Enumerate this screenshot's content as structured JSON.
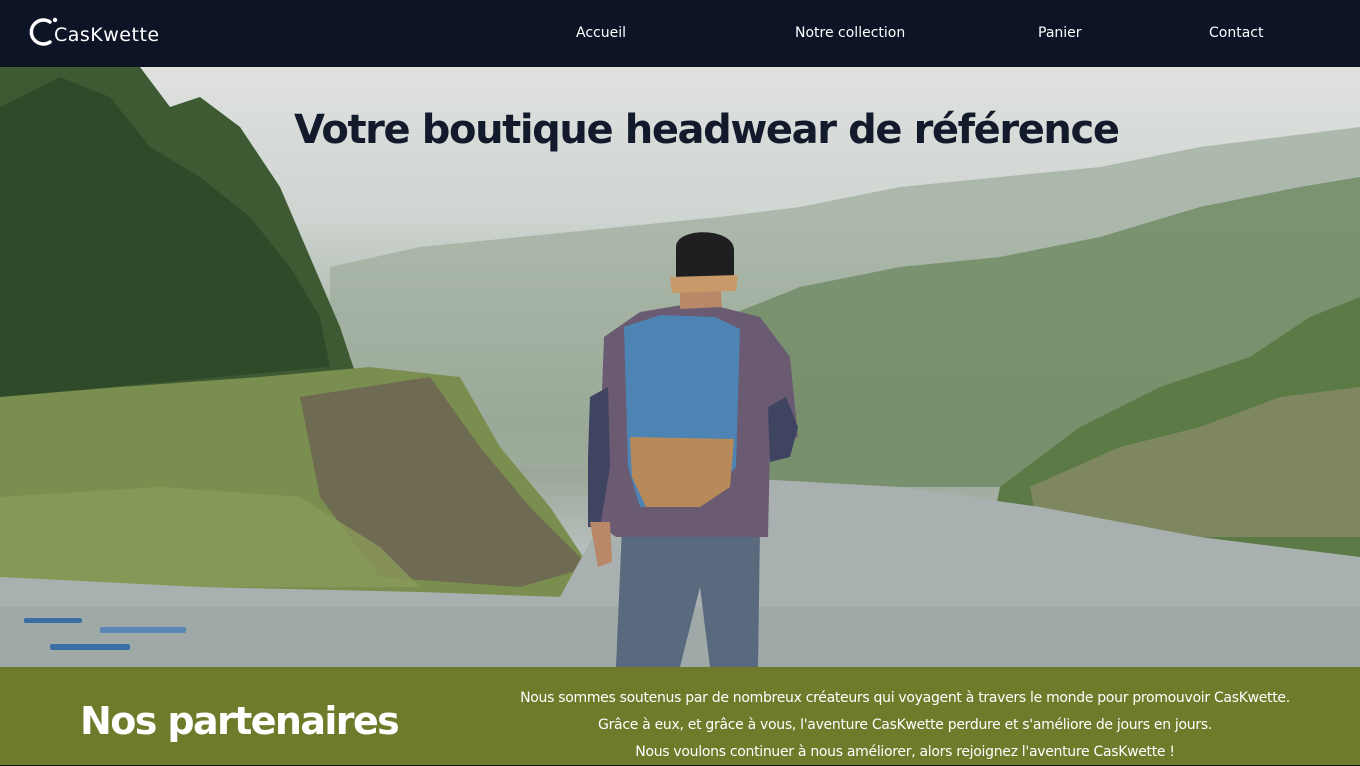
{
  "brand": {
    "name": "CasKwette"
  },
  "nav": {
    "items": [
      {
        "label": "Accueil"
      },
      {
        "label": "Notre collection"
      },
      {
        "label": "Panier"
      },
      {
        "label": "Contact"
      }
    ]
  },
  "hero": {
    "title": "Votre boutique headwear de référence",
    "image": "photo-hiker-with-cap-and-backpack-overlooking-lake-and-forested-hills"
  },
  "partners": {
    "title": "Nos partenaires",
    "lines": [
      "Nous sommes soutenus par de nombreux créateurs qui voyagent à travers le monde pour promouvoir CasKwette.",
      "Grâce à eux, et grâce à vous, l'aventure CasKwette perdure et s'améliore de jours en jours.",
      "Nous voulons continuer à nous améliorer, alors rejoignez l'aventure CasKwette !"
    ]
  },
  "colors": {
    "navbar_bg": "#0d1426",
    "partners_bg": "#6f7a2b",
    "hero_title": "#121a2c",
    "text_light": "#ffffff"
  }
}
